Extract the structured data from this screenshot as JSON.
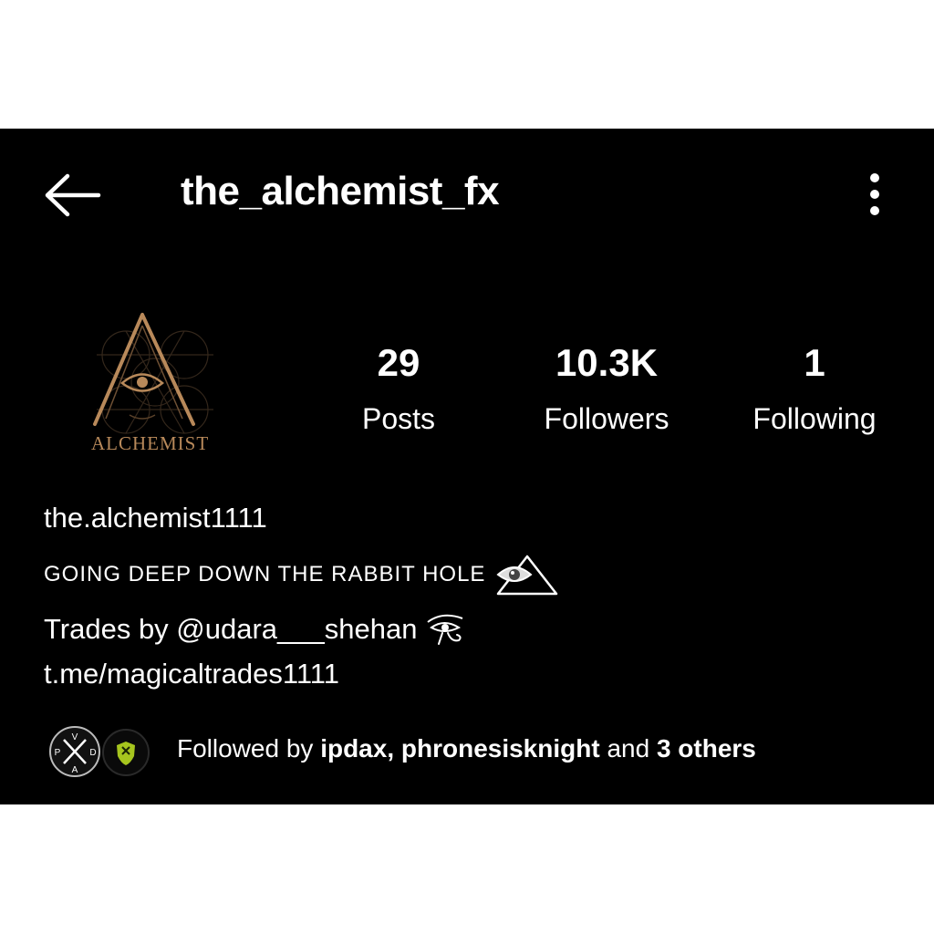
{
  "header": {
    "title": "the_alchemist_fx",
    "back_icon": "arrow-left-icon",
    "more_icon": "vertical-ellipsis-icon"
  },
  "avatar": {
    "logo_text": "ALCHEMIST",
    "accent_color": "#b8895a"
  },
  "stats": {
    "posts": {
      "count": "29",
      "label": "Posts"
    },
    "followers": {
      "count": "10.3K",
      "label": "Followers"
    },
    "following": {
      "count": "1",
      "label": "Following"
    }
  },
  "bio": {
    "name": "the.alchemist1111",
    "tagline": "GOING DEEP DOWN THE RABBIT HOLE",
    "tagline_icon": "eye-triangle-icon",
    "trades_text": "Trades by @udara___shehan",
    "trades_icon": "eye-of-horus-icon",
    "link": "t.me/magicaltrades1111"
  },
  "followed_by": {
    "prefix": "Followed by ",
    "users": "ipdax, phronesisknight",
    "middle": " and ",
    "others": "3 others",
    "avatar1_letters": "PXDA",
    "avatar2_color": "#a6c51e"
  },
  "colors": {
    "background": "#000000",
    "frame": "#ffffff",
    "text": "#ffffff"
  }
}
